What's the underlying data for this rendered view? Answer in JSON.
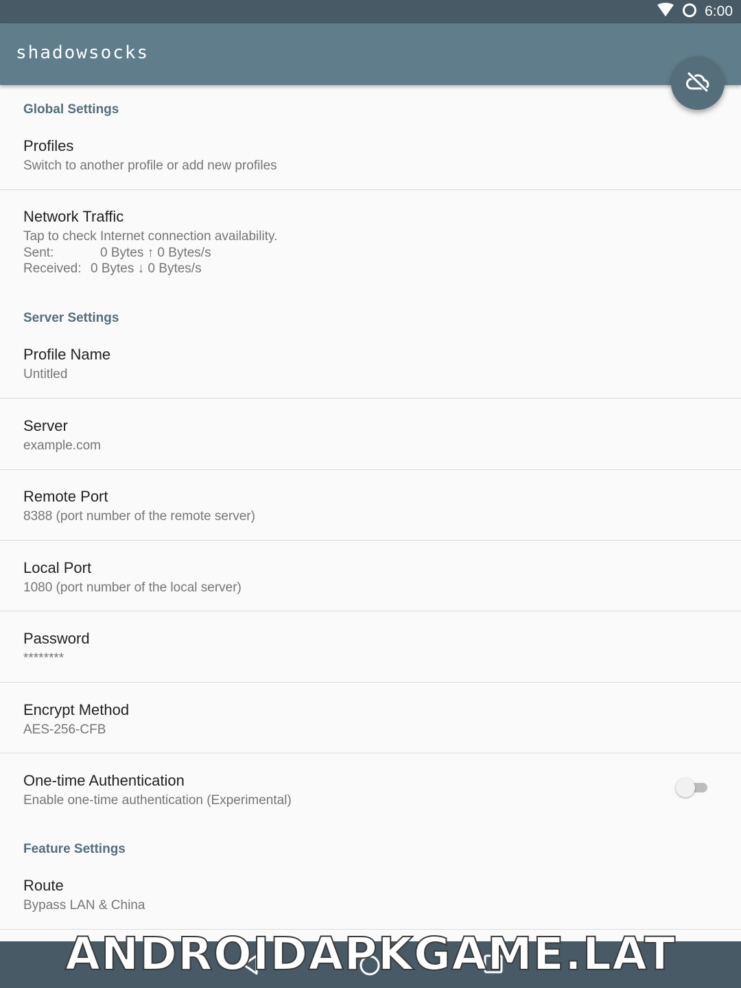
{
  "status_bar": {
    "time": "6:00",
    "icons": [
      "wifi-icon",
      "sync-circle-icon"
    ]
  },
  "app_bar": {
    "title": "shadowsocks"
  },
  "fab": {
    "icon": "cloud-off-icon"
  },
  "sections": {
    "global": "Global Settings",
    "server": "Server Settings",
    "feature": "Feature Settings"
  },
  "prefs": {
    "profiles": {
      "title": "Profiles",
      "summary": "Switch to another profile or add new profiles"
    },
    "network_traffic": {
      "title": "Network Traffic",
      "summary": "Tap to check Internet connection availability.",
      "sent_label": "Sent:",
      "sent_value": "0 Bytes ↑ 0 Bytes/s",
      "received_label": "Received:",
      "received_value": "0 Bytes ↓ 0 Bytes/s"
    },
    "profile_name": {
      "title": "Profile Name",
      "summary": "Untitled"
    },
    "server": {
      "title": "Server",
      "summary": "example.com"
    },
    "remote_port": {
      "title": "Remote Port",
      "summary": "8388 (port number of the remote server)"
    },
    "local_port": {
      "title": "Local Port",
      "summary": "1080 (port number of the local server)"
    },
    "password": {
      "title": "Password",
      "summary": "********"
    },
    "encrypt_method": {
      "title": "Encrypt Method",
      "summary": "AES-256-CFB"
    },
    "one_time_auth": {
      "title": "One-time Authentication",
      "summary": "Enable one-time authentication (Experimental)",
      "enabled": false
    },
    "route": {
      "title": "Route",
      "summary": "Bypass LAN & China"
    }
  },
  "nav_bar": {
    "icons": [
      "back-icon",
      "home-icon",
      "recents-icon"
    ]
  },
  "watermark": {
    "text": "ANDROIDAPKGAME.LAT"
  },
  "colors": {
    "primary": "#607d8b",
    "primary_dark": "#475a66",
    "accent": "#546e7a"
  }
}
